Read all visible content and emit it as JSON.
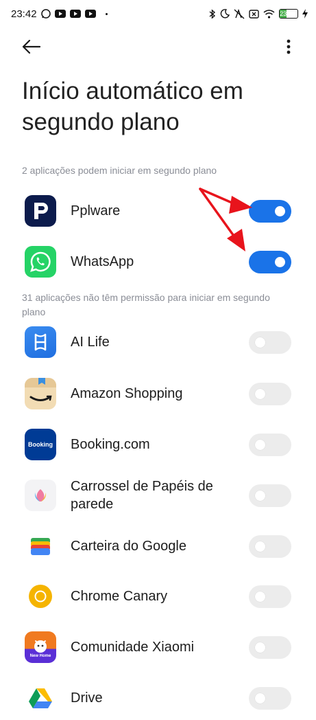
{
  "status_bar": {
    "time": "23:42",
    "battery_level": "23",
    "battery_fraction": 0.23
  },
  "header": {
    "title": "Início automático em segundo plano"
  },
  "sections": {
    "allowed_label": "2 aplicações podem iniciar em segundo plano",
    "denied_label": "31 aplicações não têm permissão para iniciar em segundo plano"
  },
  "apps": [
    {
      "name": "Pplware",
      "enabled": true,
      "icon": "pplware-icon"
    },
    {
      "name": "WhatsApp",
      "enabled": true,
      "icon": "whatsapp-icon"
    },
    {
      "name": "AI Life",
      "enabled": false,
      "icon": "ai-life-icon"
    },
    {
      "name": "Amazon Shopping",
      "enabled": false,
      "icon": "amazon-icon"
    },
    {
      "name": "Booking.com",
      "enabled": false,
      "icon": "booking-icon",
      "icon_text": "Booking"
    },
    {
      "name": "Carrossel de Papéis de parede",
      "enabled": false,
      "icon": "wallpaper-carousel-icon"
    },
    {
      "name": "Carteira do Google",
      "enabled": false,
      "icon": "google-wallet-icon"
    },
    {
      "name": "Chrome Canary",
      "enabled": false,
      "icon": "chrome-canary-icon"
    },
    {
      "name": "Comunidade Xiaomi",
      "enabled": false,
      "icon": "xiaomi-community-icon",
      "icon_text": "New Home"
    },
    {
      "name": "Drive",
      "enabled": false,
      "icon": "google-drive-icon"
    }
  ],
  "colors": {
    "toggle_on": "#1a73e8",
    "toggle_off": "#ececec",
    "annotation_arrow": "#e8141c"
  }
}
